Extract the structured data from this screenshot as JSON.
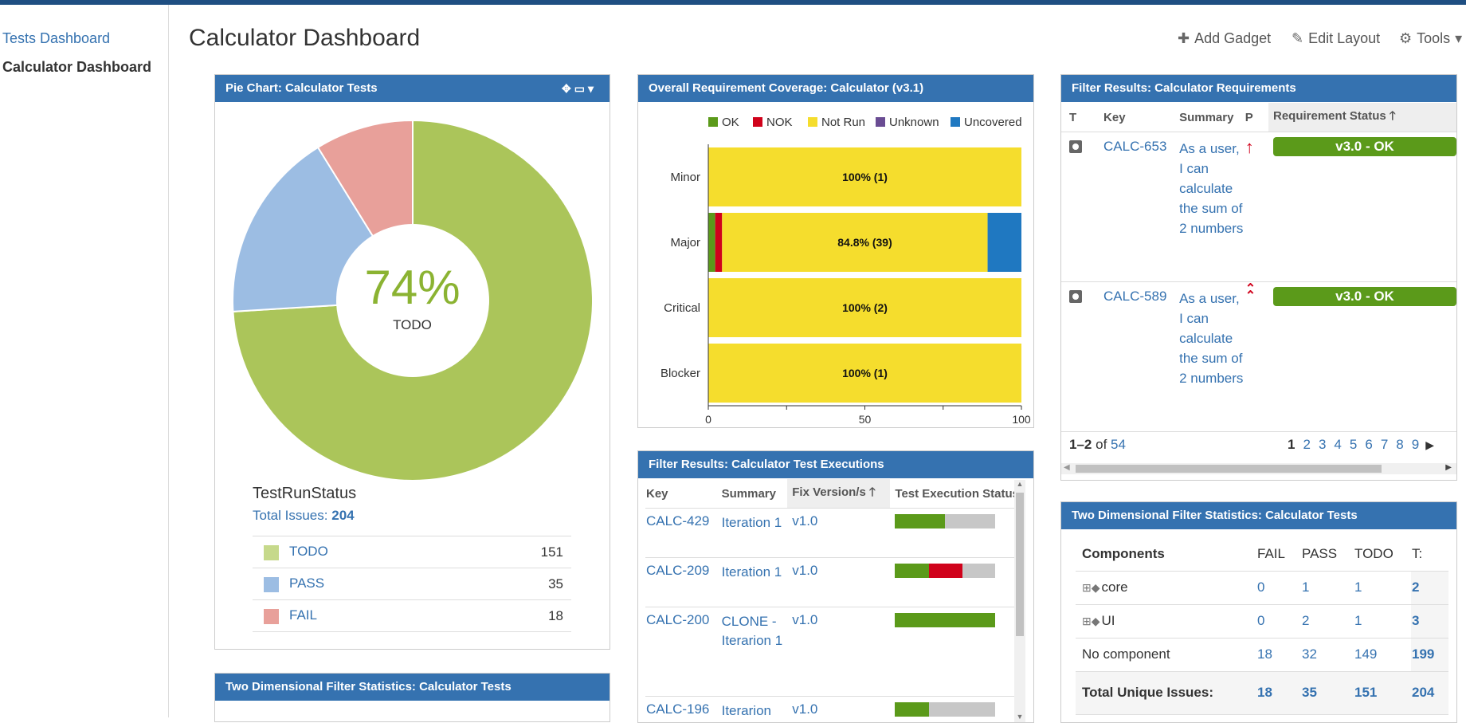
{
  "sidebar": {
    "items": [
      "Tests Dashboard",
      "Calculator Dashboard"
    ]
  },
  "page_title": "Calculator Dashboard",
  "toolbar": {
    "add_gadget": "Add Gadget",
    "edit_layout": "Edit Layout",
    "tools": "Tools"
  },
  "pie_gadget": {
    "title": "Pie Chart: Calculator Tests",
    "center_percent": "74%",
    "center_label": "TODO",
    "stat_type": "TestRunStatus",
    "total_label": "Total Issues:",
    "total": "204",
    "legend": [
      {
        "label": "TODO",
        "count": "151",
        "color": "#abc55a"
      },
      {
        "label": "PASS",
        "count": "35",
        "color": "#9cbde3"
      },
      {
        "label": "FAIL",
        "count": "18",
        "color": "#e8a09a"
      }
    ]
  },
  "chart_data": {
    "type": "bar",
    "orientation": "horizontal",
    "stacked": true,
    "title": "Overall Requirement Coverage: Calculator (v3.1)",
    "categories": [
      "Minor",
      "Major",
      "Critical",
      "Blocker"
    ],
    "legend": [
      "OK",
      "NOK",
      "Not Run",
      "Unknown",
      "Uncovered"
    ],
    "legend_colors": [
      "#5b9a1a",
      "#d0021b",
      "#f5dd2d",
      "#6a4c93",
      "#1f78c1"
    ],
    "series": [
      {
        "name": "OK",
        "values": [
          0,
          2.2,
          0,
          0
        ]
      },
      {
        "name": "NOK",
        "values": [
          0,
          2.2,
          0,
          0
        ]
      },
      {
        "name": "Not Run",
        "values": [
          100,
          84.8,
          100,
          100
        ]
      },
      {
        "name": "Unknown",
        "values": [
          0,
          0,
          0,
          0
        ]
      },
      {
        "name": "Uncovered",
        "values": [
          0,
          10.8,
          0,
          0
        ]
      }
    ],
    "bar_labels": [
      "100% (1)",
      "84.8% (39)",
      "100% (2)",
      "100% (1)"
    ],
    "xticks": [
      "0",
      "50",
      "100"
    ],
    "xlim": [
      0,
      100
    ]
  },
  "exec_gadget": {
    "title": "Filter Results: Calculator Test Executions",
    "columns": [
      "Key",
      "Summary",
      "Fix Version/s",
      "Test Execution Status"
    ],
    "sort_arrow": "🡑",
    "rows": [
      {
        "key": "CALC-429",
        "summary": "Iteration 1",
        "fix": "v1.0",
        "pass": 0.5,
        "fail": 0,
        "todo": 0.5
      },
      {
        "key": "CALC-209",
        "summary": "Iteration 1",
        "fix": "v1.0",
        "pass": 0.34,
        "fail": 0.33,
        "todo": 0.33
      },
      {
        "key": "CALC-200",
        "summary": "CLONE - Iterarion 1",
        "fix": "v1.0",
        "pass": 1.0,
        "fail": 0,
        "todo": 0
      },
      {
        "key": "CALC-196",
        "summary": "Iterarion",
        "fix": "v1.0",
        "pass": 0.34,
        "fail": 0,
        "todo": 0.66
      }
    ]
  },
  "req_gadget": {
    "title": "Filter Results: Calculator Requirements",
    "columns": [
      "T",
      "Key",
      "Summary",
      "P",
      "Requirement Status"
    ],
    "sort_arrow": "🡑",
    "rows": [
      {
        "key": "CALC-653",
        "summary": "As a user, I can calculate the sum of 2 numbers",
        "priority": "↑",
        "status": "v3.0 - OK"
      },
      {
        "key": "CALC-589",
        "summary": "As a user, I can calculate the sum of 2 numbers",
        "priority": "⌃⌃",
        "status": "v3.0 - OK"
      }
    ],
    "pagination": {
      "range": "1–2",
      "of": "of",
      "total": "54",
      "pages": [
        "1",
        "2",
        "3",
        "4",
        "5",
        "6",
        "7",
        "8",
        "9"
      ],
      "next": "▶"
    }
  },
  "stats_gadget": {
    "title": "Two Dimensional Filter Statistics: Calculator Tests",
    "columns": [
      "Components",
      "FAIL",
      "PASS",
      "TODO",
      "T:"
    ],
    "rows": [
      {
        "label": "core",
        "fail": "0",
        "pass": "1",
        "todo": "1",
        "total": "2"
      },
      {
        "label": "UI",
        "fail": "0",
        "pass": "2",
        "todo": "1",
        "total": "3"
      },
      {
        "label": "No component",
        "fail": "18",
        "pass": "32",
        "todo": "149",
        "total": "199"
      }
    ],
    "total_row": {
      "label": "Total Unique Issues:",
      "fail": "18",
      "pass": "35",
      "todo": "151",
      "total": "204"
    }
  },
  "stats_gadget_2": {
    "title": "Two Dimensional Filter Statistics: Calculator Tests"
  }
}
